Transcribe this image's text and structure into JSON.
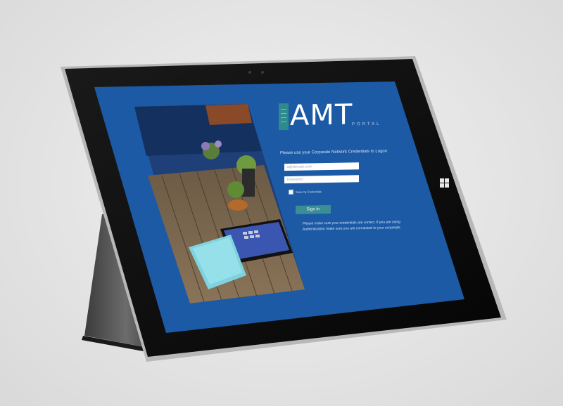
{
  "logo": {
    "text": "AMT",
    "subtitle": "PORTAL"
  },
  "login": {
    "prompt": "Please use your Corporate Network Credentials to Logon",
    "email_placeholder": "a@domain.com",
    "password_placeholder": "Password",
    "remember_label": "Save my Credentials",
    "signin_label": "Sign In",
    "notice": "Please make sure your credentials are correct. If you are using integrated Windows Authentication make sure you are connected to your corporate network."
  },
  "colors": {
    "screen_blue": "#1c5aa6",
    "accent_teal": "#3b8f94",
    "bezel": "#0d0d0d"
  },
  "icons": {
    "windows_button": "windows-logo-icon",
    "camera": "camera-icon"
  }
}
